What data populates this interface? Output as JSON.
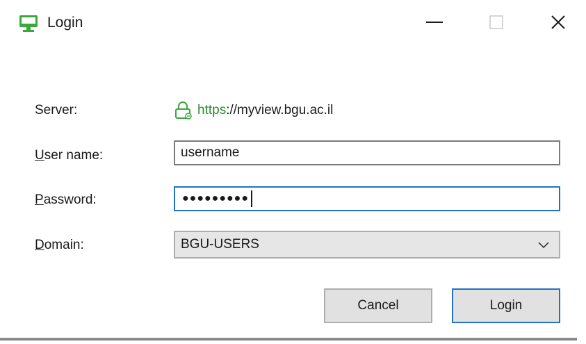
{
  "window": {
    "title": "Login",
    "accent_color": "#2d8a2d",
    "focus_color": "#1e73c8"
  },
  "server": {
    "label_prefix": "",
    "label_accel": "",
    "label_rest": "Server:",
    "url_scheme": "https",
    "url_rest": "://myview.bgu.ac.il"
  },
  "username": {
    "label_accel": "U",
    "label_rest": "ser name:",
    "value": "username"
  },
  "password": {
    "label_accel": "P",
    "label_rest": "assword:",
    "masked_value": "●●●●●●●●●"
  },
  "domain": {
    "label_accel": "D",
    "label_rest": "omain:",
    "selected": "BGU-USERS"
  },
  "buttons": {
    "cancel": "Cancel",
    "login": "Login"
  }
}
